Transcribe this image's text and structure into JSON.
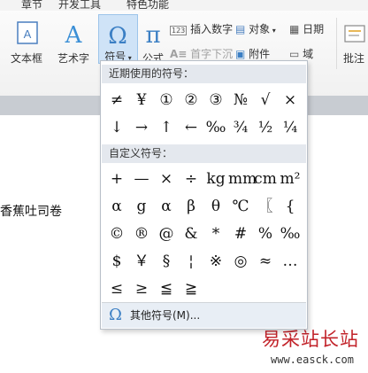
{
  "tabs": [
    "章节",
    "开发工具",
    "特色功能"
  ],
  "ribbon": {
    "textbox": "文本框",
    "arttext": "艺术字",
    "symbol": "符号",
    "formula": "公式",
    "insert_number": "插入数字",
    "dropcap": "首字下沉",
    "object": "对象",
    "attachment": "附件",
    "date": "日期",
    "field": "域",
    "comment": "批注"
  },
  "dropdown": {
    "recent_label": "近期使用的符号：",
    "recent": [
      "≠",
      "¥",
      "①",
      "②",
      "③",
      "№",
      "√",
      "×",
      "↓",
      "→",
      "↑",
      "←",
      "‰",
      "¾",
      "½",
      "¼"
    ],
    "custom_label": "自定义符号：",
    "custom": [
      "+",
      "—",
      "×",
      "÷",
      "kg",
      "mm",
      "cm",
      "m²",
      "α",
      "g",
      "α",
      "β",
      "θ",
      "℃",
      "〖",
      "{",
      "©",
      "®",
      "@",
      "&",
      "*",
      "#",
      "%",
      "‰",
      "$",
      "￥",
      "§",
      "¦",
      "※",
      "◎",
      "≈",
      "…",
      "≤",
      "≥",
      "≦",
      "≧"
    ],
    "more": "其他符号(M)..."
  },
  "document": {
    "text": "香蕉吐司卷"
  },
  "watermark": {
    "name": "易采站长站",
    "url": "www.easck.com"
  }
}
